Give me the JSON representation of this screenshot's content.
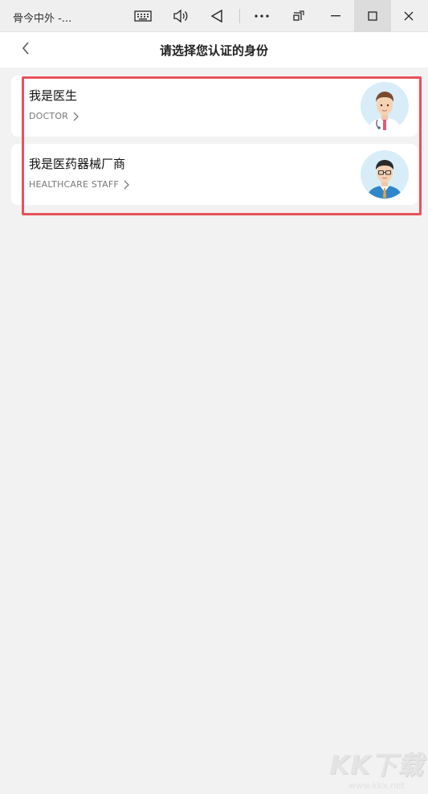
{
  "window": {
    "app_title": "骨今中外 -...",
    "icons": [
      "keyboard-icon",
      "volume-icon",
      "back-triangle-icon",
      "more-icon",
      "snap-icon",
      "minimize-icon",
      "maximize-icon",
      "close-icon"
    ]
  },
  "header": {
    "title": "请选择您认证的身份"
  },
  "options": [
    {
      "title": "我是医生",
      "subtitle": "DOCTOR",
      "avatar": "doctor-avatar"
    },
    {
      "title": "我是医药器械厂商",
      "subtitle": "HEALTHCARE STAFF",
      "avatar": "staff-avatar"
    }
  ],
  "watermark": {
    "brand": "KK下载",
    "url": "www.kkx.net"
  },
  "colors": {
    "highlight": "#e8525a",
    "avatar_bg": "#d8edf7",
    "background": "#f2f2f2"
  }
}
